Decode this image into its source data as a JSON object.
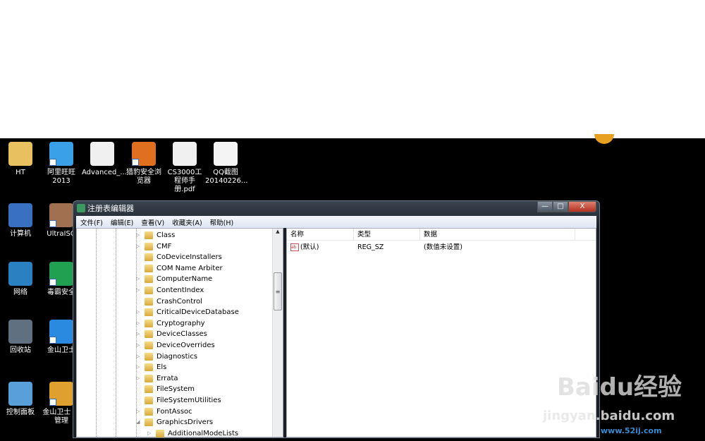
{
  "desktop": {
    "icons": [
      {
        "label": "HT",
        "color": "#e8c060"
      },
      {
        "label": "阿里旺旺 2013",
        "color": "#3aa0e8",
        "shortcut": true
      },
      {
        "label": "Advanced_...",
        "color": "#f0f0f0"
      },
      {
        "label": "猎豹安全浏览器",
        "color": "#e07020",
        "shortcut": true
      },
      {
        "label": "CS3000工程师手册.pdf",
        "color": "#f0f0f0"
      },
      {
        "label": "QQ截图 20140226...",
        "color": "#f4f4f4"
      },
      {
        "label": "计算机",
        "color": "#3a70c0"
      },
      {
        "label": "UltraISO",
        "color": "#a07050",
        "shortcut": true
      },
      {
        "label": "网络",
        "color": "#2a80c0"
      },
      {
        "label": "毒霸安全",
        "color": "#20a050",
        "shortcut": true
      },
      {
        "label": "回收站",
        "color": "#607080"
      },
      {
        "label": "金山卫士",
        "color": "#2a8ae0",
        "shortcut": true
      },
      {
        "label": "控制面板",
        "color": "#5aa0d8"
      },
      {
        "label": "金山卫士 件管理",
        "color": "#e0a030",
        "shortcut": true
      }
    ]
  },
  "window": {
    "title": "注册表编辑器",
    "buttons": {
      "min": "—",
      "max": "□",
      "close": "X"
    }
  },
  "menu": [
    "文件(F)",
    "编辑(E)",
    "查看(V)",
    "收藏夹(A)",
    "帮助(H)"
  ],
  "tree": [
    {
      "name": "Class",
      "exp": true
    },
    {
      "name": "CMF",
      "exp": true
    },
    {
      "name": "CoDeviceInstallers",
      "exp": false
    },
    {
      "name": "COM Name Arbiter",
      "exp": false
    },
    {
      "name": "ComputerName",
      "exp": true
    },
    {
      "name": "ContentIndex",
      "exp": true
    },
    {
      "name": "CrashControl",
      "exp": false
    },
    {
      "name": "CriticalDeviceDatabase",
      "exp": true
    },
    {
      "name": "Cryptography",
      "exp": true
    },
    {
      "name": "DeviceClasses",
      "exp": true
    },
    {
      "name": "DeviceOverrides",
      "exp": true
    },
    {
      "name": "Diagnostics",
      "exp": true
    },
    {
      "name": "Els",
      "exp": true
    },
    {
      "name": "Errata",
      "exp": true
    },
    {
      "name": "FileSystem",
      "exp": false
    },
    {
      "name": "FileSystemUtilities",
      "exp": false
    },
    {
      "name": "FontAssoc",
      "exp": true
    },
    {
      "name": "GraphicsDrivers",
      "exp": "open"
    },
    {
      "name": "AdditionalModeLists",
      "exp": true,
      "child": true
    }
  ],
  "values": {
    "headers": [
      "名称",
      "类型",
      "数据"
    ],
    "rows": [
      {
        "name": "(默认)",
        "type": "REG_SZ",
        "data": "(数值未设置)"
      }
    ]
  },
  "watermark": {
    "brand": "Baidu经验",
    "url": "jingyan.baidu.com",
    "site": "www.52ij.com"
  }
}
